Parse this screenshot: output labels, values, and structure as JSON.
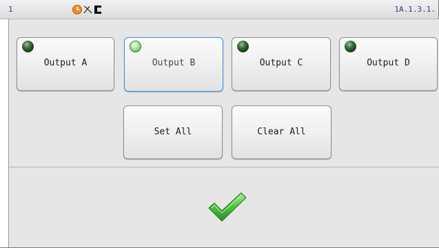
{
  "titlebar": {
    "number": "1",
    "version": "1A.1.3.1.",
    "icons": [
      "clock-icon",
      "signal-icon",
      "panel-icon"
    ]
  },
  "outputs": [
    {
      "label": "Output A",
      "state": "off"
    },
    {
      "label": "Output B",
      "state": "on",
      "selected": true
    },
    {
      "label": "Output C",
      "state": "off"
    },
    {
      "label": "Output D",
      "state": "off"
    }
  ],
  "actions": {
    "set_all": "Set All",
    "clear_all": "Clear All"
  },
  "confirm_icon": "checkmark-icon",
  "colors": {
    "led_off": "#1f4a1f",
    "led_on": "#8ee083",
    "selected_border": "#3c8fd3",
    "check_green": "#3db83a",
    "background": "#e6e6e6"
  }
}
